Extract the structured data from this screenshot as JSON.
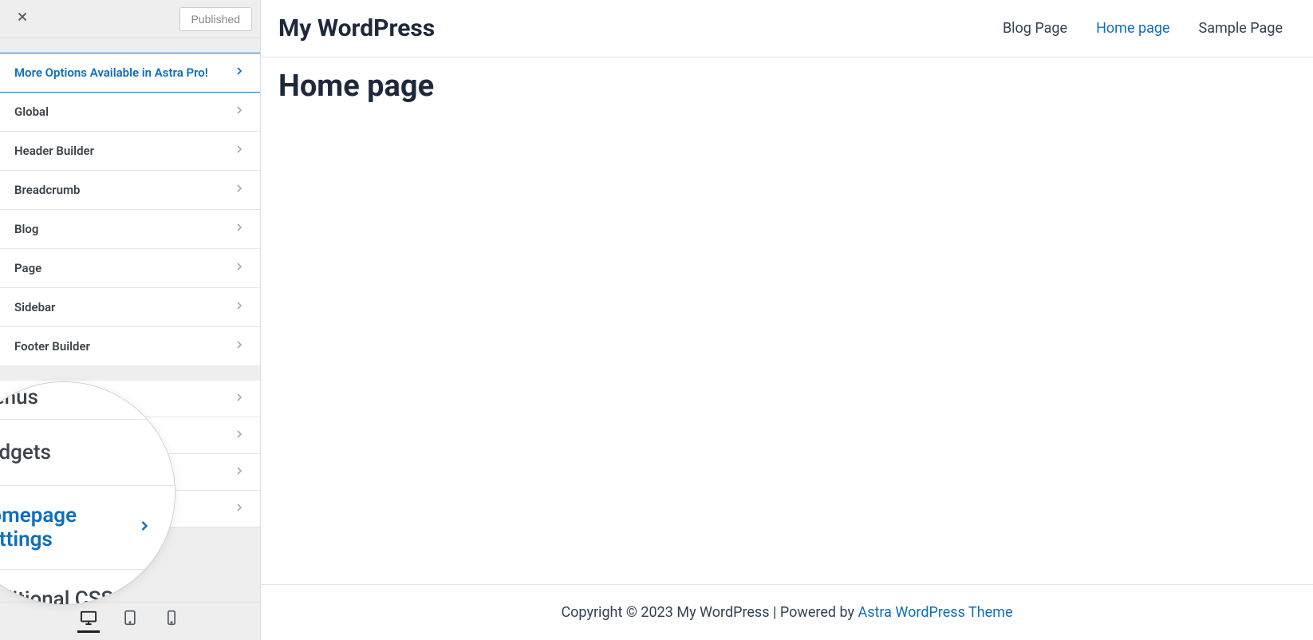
{
  "sidebar": {
    "published_label": "Published",
    "promo_label": "More Options Available in Astra Pro!",
    "items": [
      {
        "label": "Global"
      },
      {
        "label": "Header Builder"
      },
      {
        "label": "Breadcrumb"
      },
      {
        "label": "Blog"
      },
      {
        "label": "Page"
      },
      {
        "label": "Sidebar"
      },
      {
        "label": "Footer Builder"
      }
    ],
    "magnified": {
      "menus": "Menus",
      "widgets": "Widgets",
      "homepage": "Homepage Settings",
      "css": "Additional CSS"
    }
  },
  "preview": {
    "site_title": "My WordPress",
    "nav": [
      {
        "label": "Blog Page",
        "active": false
      },
      {
        "label": "Home page",
        "active": true
      },
      {
        "label": "Sample Page",
        "active": false
      }
    ],
    "page_heading": "Home page",
    "footer_text": "Copyright © 2023 My WordPress | Powered by ",
    "footer_link": "Astra WordPress Theme"
  }
}
